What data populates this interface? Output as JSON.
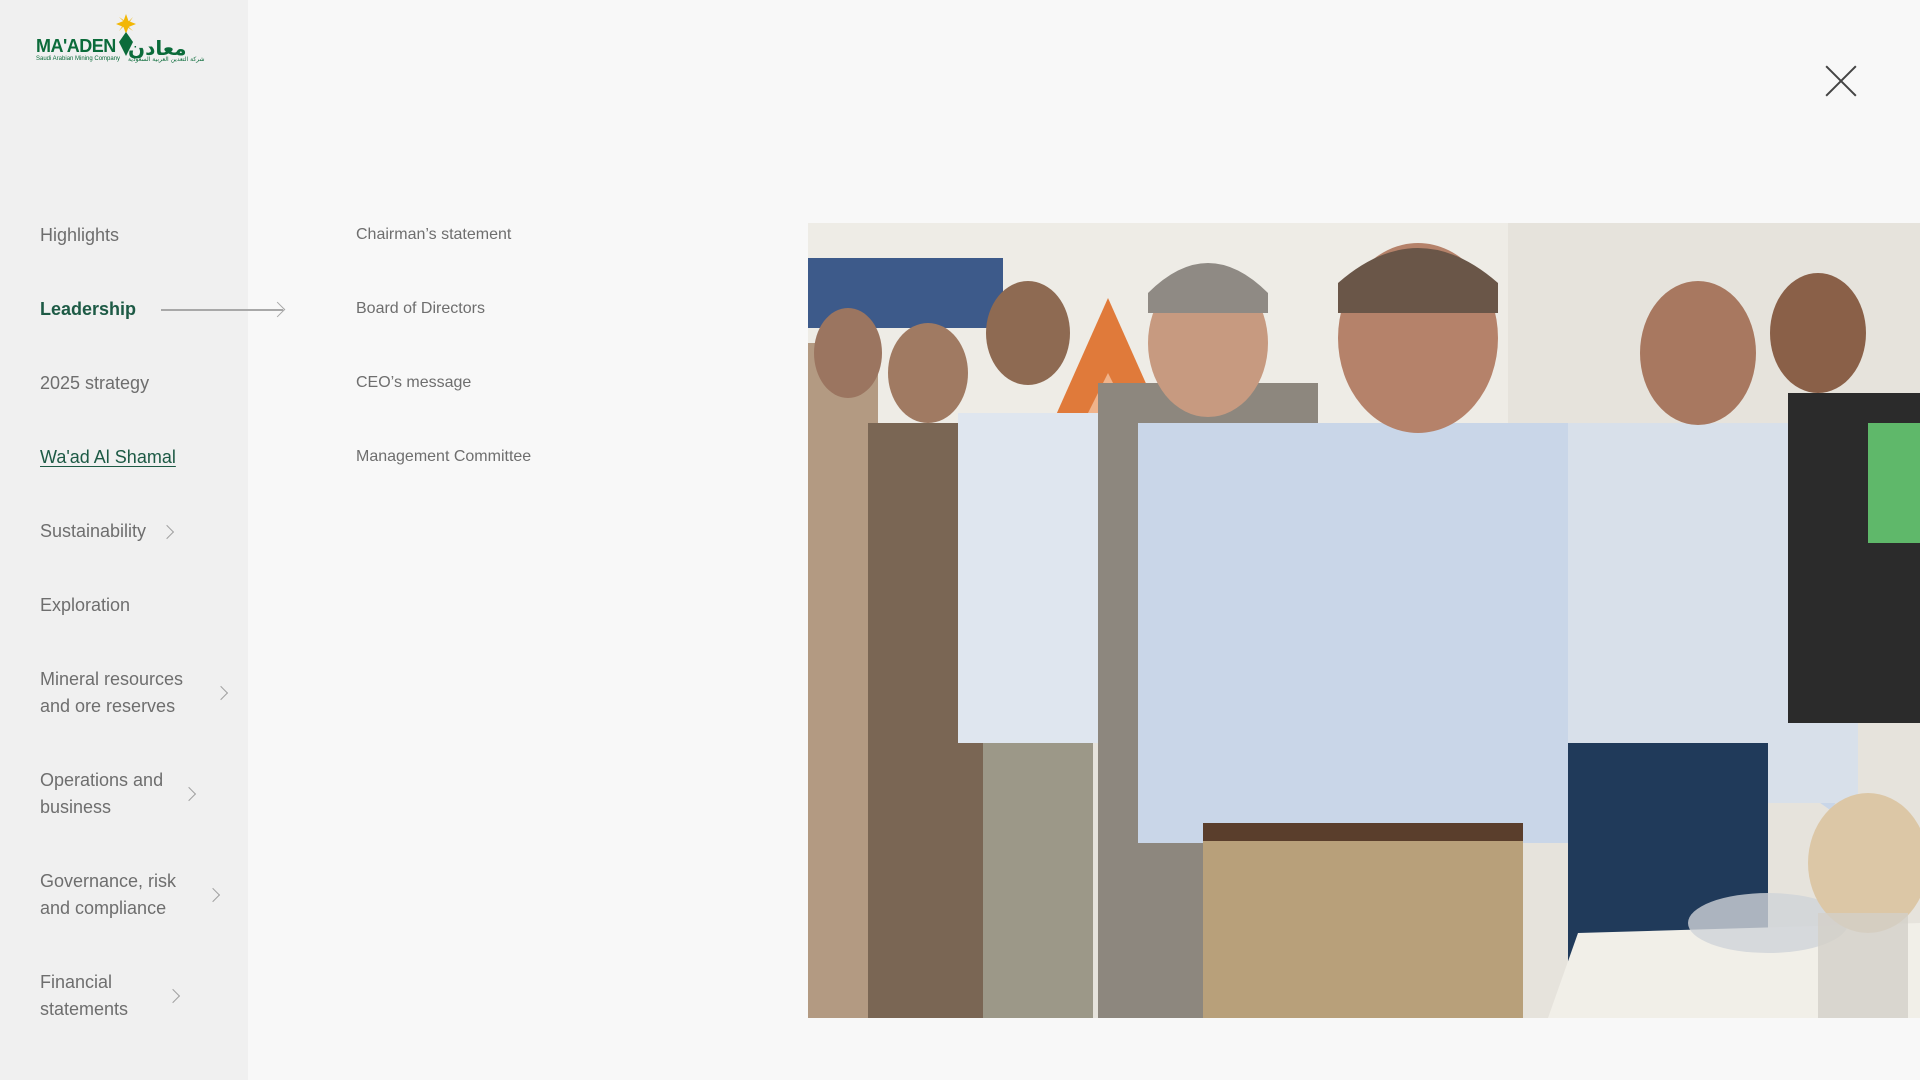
{
  "logo": {
    "name_en": "MA'ADEN",
    "tagline_en": "Saudi Arabian Mining Company",
    "name_ar": "معادن",
    "tagline_ar": "شركة التعدين العربية السعودية"
  },
  "nav": {
    "items": [
      {
        "label": "Highlights",
        "has_chevron": false
      },
      {
        "label": "Leadership",
        "has_chevron": false,
        "state": "active"
      },
      {
        "label": "2025 strategy",
        "has_chevron": false
      },
      {
        "label": "Wa'ad Al Shamal",
        "has_chevron": false,
        "state": "link"
      },
      {
        "label": "Sustainability",
        "has_chevron": true
      },
      {
        "label": "Exploration",
        "has_chevron": false
      },
      {
        "label": "Mineral resources and ore reserves",
        "has_chevron": true
      },
      {
        "label": "Operations and business",
        "has_chevron": true
      },
      {
        "label": "Governance, risk and compliance",
        "has_chevron": true
      },
      {
        "label": "Financial statements",
        "has_chevron": true
      }
    ]
  },
  "submenu": {
    "items": [
      "Chairman’s statement",
      "Board of Directors",
      "CEO’s message",
      "Management Committee"
    ]
  },
  "icons": {
    "close": "close-icon",
    "chevron": "chevron-right-icon",
    "arrow": "arrow-right-icon"
  },
  "colors": {
    "brand_green": "#0b6b3a",
    "active_text": "#1d5a45",
    "nav_text": "#6e6e6e",
    "sidebar_bg": "#f0f0f0",
    "page_bg": "#f8f8f8",
    "logo_star": "#f2b705"
  }
}
